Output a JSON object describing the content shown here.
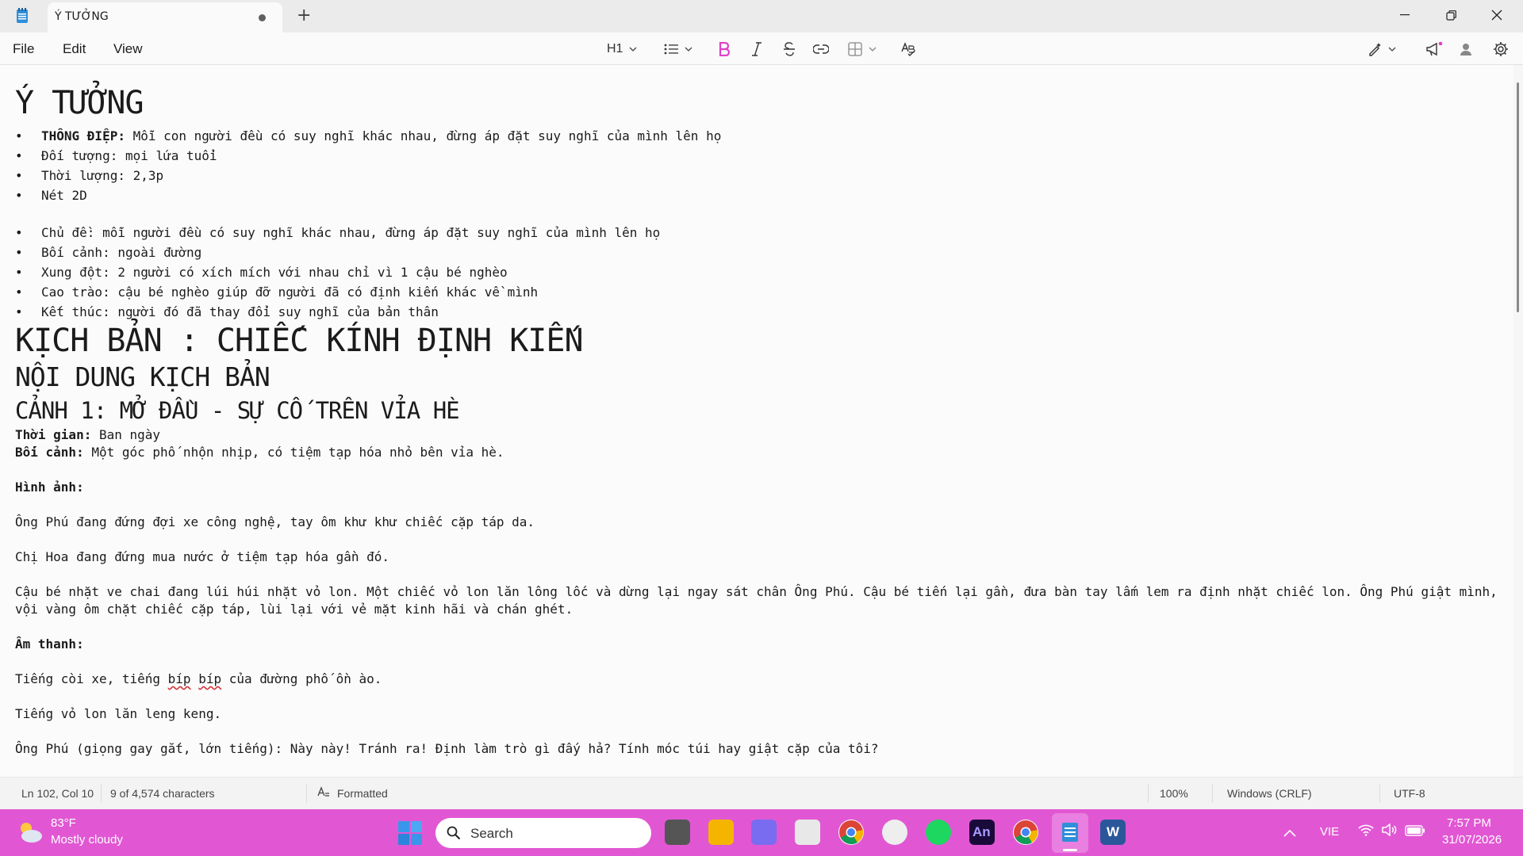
{
  "tab": {
    "title": "Ý TƯỞNG"
  },
  "menu": {
    "file": "File",
    "edit": "Edit",
    "view": "View"
  },
  "toolbar": {
    "heading": "H1"
  },
  "content": {
    "title": "Ý TƯỞNG",
    "list1": [
      {
        "bold": "THÔNG ĐIỆP:",
        "text": " Mỗi con người đều có suy nghĩ khác nhau, đừng áp đặt suy nghĩ của mình lên họ"
      },
      {
        "bold": "",
        "text": "Đối tượng: mọi lứa tuổi"
      },
      {
        "bold": "",
        "text": "Thời lượng: 2,3p"
      },
      {
        "bold": "",
        "text": "Nét 2D"
      }
    ],
    "list2": [
      "Chủ đề: mỗi người đều có suy nghĩ khác nhau, đừng áp đặt suy nghĩ của mình lên họ",
      "Bối cảnh: ngoài đường",
      "Xung đột: 2 người có xích mích với nhau chỉ vì 1 cậu bé nghèo",
      "Cao trào: cậu bé nghèo giúp đỡ người đã có định kiến khác về mình",
      "Kết thúc: người đó đã thay đổi suy nghĩ của bản thân"
    ],
    "script_title": "KỊCH BẢN : CHIẾC KÍNH ĐỊNH KIẾN",
    "script_content": "NỘI DUNG KỊCH BẢN",
    "scene1": "CẢNH 1: MỞ ĐẦU - SỰ CỐ TRÊN VỈA HÈ",
    "time_label": "Thời gian:",
    "time_value": " Ban ngày",
    "setting_label": "Bối cảnh:",
    "setting_value": " Một góc phố nhộn nhịp, có tiệm tạp hóa nhỏ bên vỉa hè.",
    "image_label": "Hình ảnh:",
    "image_p1": "Ông Phú đang đứng đợi xe công nghệ, tay ôm khư khư chiếc cặp táp da.",
    "image_p2": "Chị Hoa đang đứng mua nước ở tiệm tạp hóa gần đó.",
    "image_p3": "Cậu bé nhặt ve chai đang lúi húi nhặt vỏ lon. Một chiếc vỏ lon lăn lông lốc và dừng lại ngay sát chân Ông Phú. Cậu bé tiến lại gần, đưa bàn tay lấm lem ra định nhặt chiếc lon. Ông Phú giật mình, vội vàng ôm chặt chiếc cặp táp, lùi lại với vẻ mặt kinh hãi và chán ghét.",
    "sound_label": "Âm thanh:",
    "sound_p1_a": "Tiếng còi xe, tiếng ",
    "sound_p1_b": "bíp",
    "sound_p1_c": " ",
    "sound_p1_d": "bíp",
    "sound_p1_e": " của đường phố ồn ào.",
    "sound_p2": "Tiếng vỏ lon lăn leng keng.",
    "dialog1": "Ông Phú (giọng gay gắt, lớn tiếng): Này này! Tránh ra! Định làm trò gì đấy hả? Tính móc túi hay giật cặp của tôi?"
  },
  "status": {
    "position": "Ln 102, Col 10",
    "chars": "9 of 4,574 characters",
    "format": "Formatted",
    "zoom": "100%",
    "line_ending": "Windows (CRLF)",
    "encoding": "UTF-8"
  },
  "taskbar": {
    "temp": "83°F",
    "weather": "Mostly cloudy",
    "search": "Search",
    "lang": "VIE",
    "time": "7:57 PM",
    "date": "31/07/2026"
  },
  "colors": {
    "taskbar": "#e157d3",
    "bold_icon": "#e040c8"
  }
}
